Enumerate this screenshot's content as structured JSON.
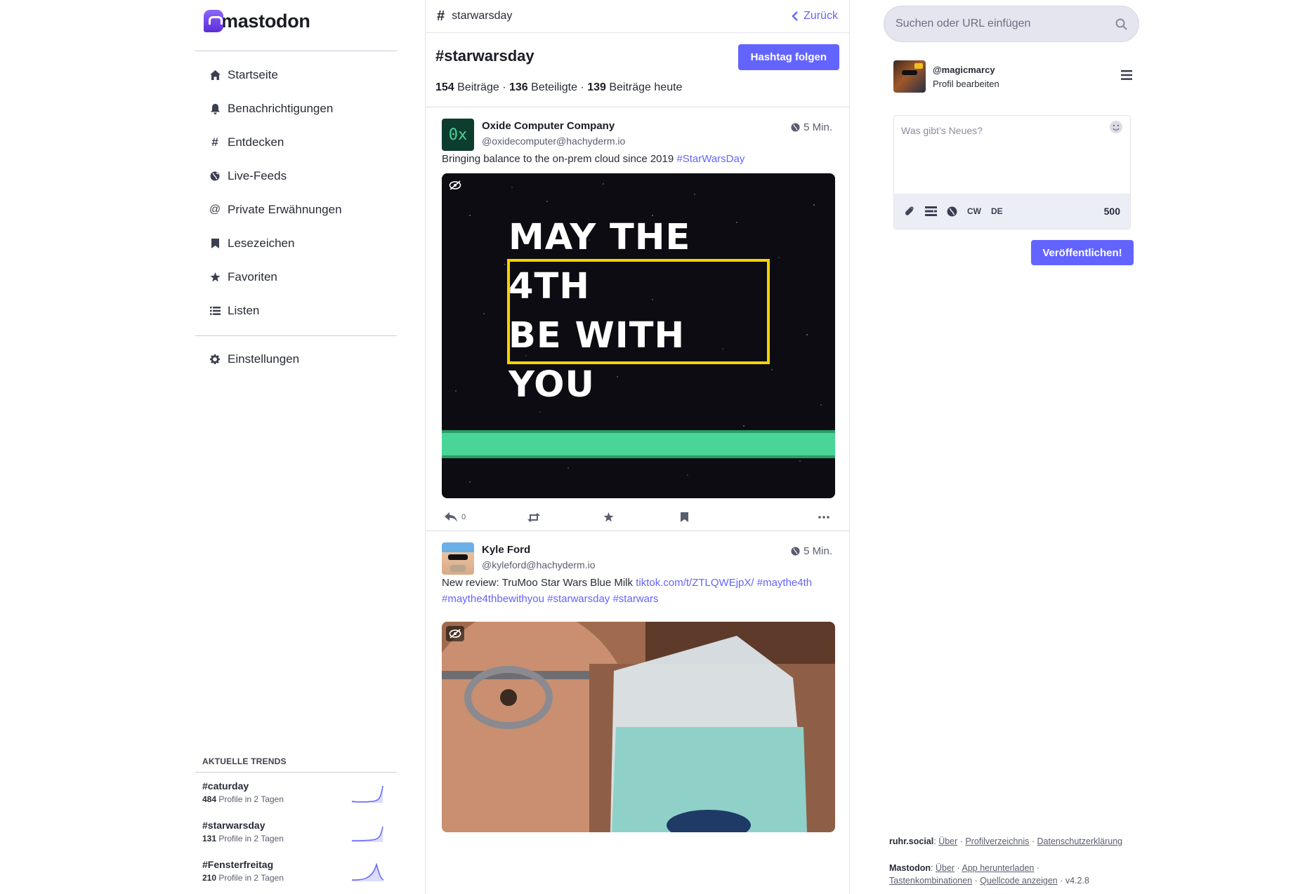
{
  "app": {
    "logo_text": "mastodon",
    "brand_color": "#6364ff"
  },
  "nav": {
    "items": [
      {
        "label": "Startseite",
        "icon": "home-icon"
      },
      {
        "label": "Benachrichtigungen",
        "icon": "bell-icon"
      },
      {
        "label": "Entdecken",
        "icon": "hashtag-icon"
      },
      {
        "label": "Live-Feeds",
        "icon": "globe-icon"
      },
      {
        "label": "Private Erwähnungen",
        "icon": "at-icon"
      },
      {
        "label": "Lesezeichen",
        "icon": "bookmark-icon"
      },
      {
        "label": "Favoriten",
        "icon": "star-icon"
      },
      {
        "label": "Listen",
        "icon": "list-icon"
      }
    ],
    "settings": {
      "label": "Einstellungen",
      "icon": "gear-icon"
    }
  },
  "trends": {
    "title": "AKTUELLE TRENDS",
    "items": [
      {
        "tag": "#caturday",
        "count": "484",
        "suffix": "Profile in 2 Tagen"
      },
      {
        "tag": "#starwarsday",
        "count": "131",
        "suffix": "Profile in 2 Tagen"
      },
      {
        "tag": "#Fensterfreitag",
        "count": "210",
        "suffix": "Profile in 2 Tagen"
      }
    ]
  },
  "column": {
    "hash": "#",
    "title": "starwarsday",
    "back_label": "Zurück"
  },
  "hashtag": {
    "name": "#starwarsday",
    "follow_label": "Hashtag folgen",
    "posts_count": "154",
    "posts_label": "Beiträge",
    "participants_count": "136",
    "participants_label": "Beteiligte",
    "today_count": "139",
    "today_label": "Beiträge heute",
    "sep": "·"
  },
  "posts": [
    {
      "author": "Oxide Computer Company",
      "handle": "@oxidecomputer@hachyderm.io",
      "time": "5 Min.",
      "avatar_text": "0x",
      "text": "Bringing balance to the on-prem cloud since 2019",
      "tags": "#StarWarsDay",
      "image_text_line1": "MAY THE 4TH",
      "image_text_line2": "BE WITH YOU",
      "reply_count": "0"
    },
    {
      "author": "Kyle Ford",
      "handle": "@kyleford@hachyderm.io",
      "time": "5 Min.",
      "text": "New review: TruMoo Star Wars Blue Milk",
      "link": "tiktok.com/t/ZTLQWEjpX/",
      "tags_line1": "#maythe4th",
      "tags_line2": "#maythe4thbewithyou #starwarsday #starwars"
    }
  ],
  "search": {
    "placeholder": "Suchen oder URL einfügen"
  },
  "account": {
    "handle": "@magicmarcy",
    "edit_label": "Profil bearbeiten"
  },
  "compose": {
    "placeholder": "Was gibt’s Neues?",
    "cw_label": "CW",
    "lang_label": "DE",
    "char_count": "500",
    "publish_label": "Veröffentlichen!"
  },
  "footer": {
    "server": "ruhr.social",
    "server_links": [
      "Über",
      "Profilverzeichnis",
      "Datenschutzerklärung"
    ],
    "mastodon_label": "Mastodon",
    "mastodon_links": [
      "Über",
      "App herunterladen",
      "Tastenkombinationen",
      "Quellcode anzeigen"
    ],
    "version": "v4.2.8"
  }
}
